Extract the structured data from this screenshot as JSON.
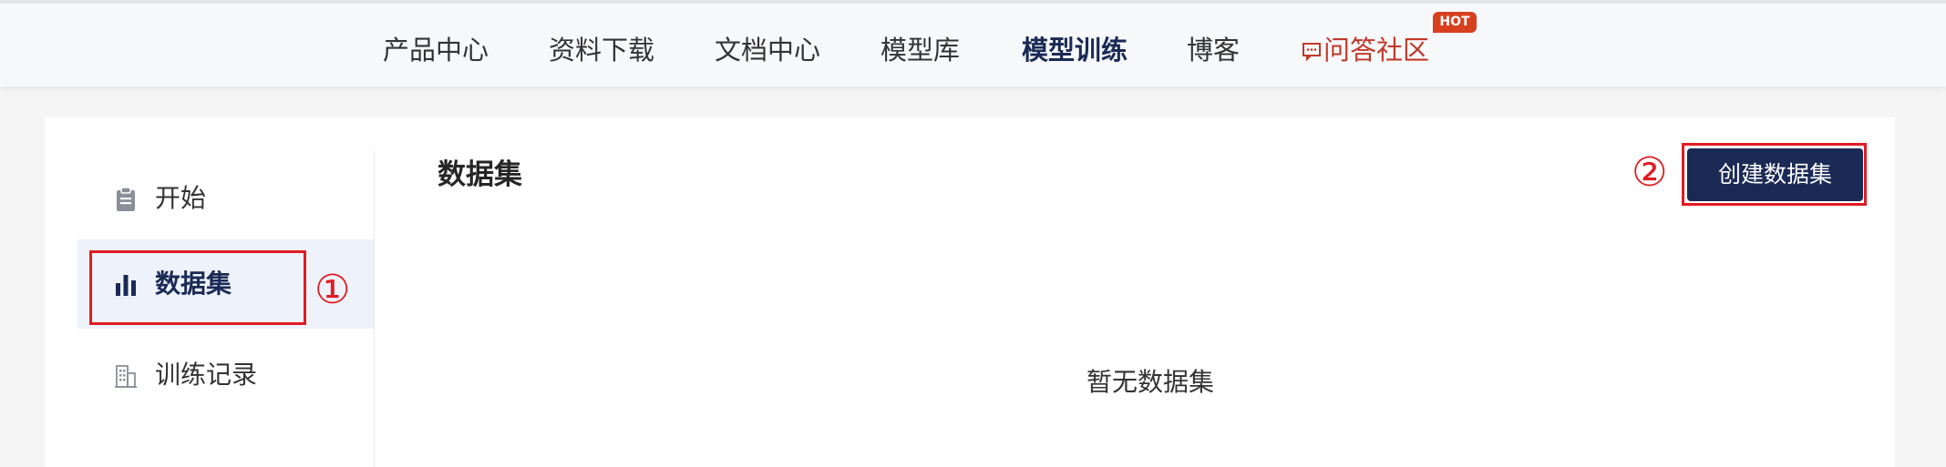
{
  "top_nav": {
    "items": [
      {
        "label": "产品中心"
      },
      {
        "label": "资料下载"
      },
      {
        "label": "文档中心"
      },
      {
        "label": "模型库"
      },
      {
        "label": "模型训练",
        "active": true
      },
      {
        "label": "博客"
      },
      {
        "label": "问答社区",
        "icon": "chat-icon"
      }
    ],
    "hot_badge": "HOT"
  },
  "sidebar": {
    "items": [
      {
        "label": "开始",
        "icon": "clipboard-icon"
      },
      {
        "label": "数据集",
        "icon": "bar-chart-icon",
        "active": true
      },
      {
        "label": "训练记录",
        "icon": "building-icon"
      }
    ]
  },
  "main": {
    "title": "数据集",
    "create_button": "创建数据集",
    "empty_text": "暂无数据集"
  },
  "annotations": {
    "marker_1": "①",
    "marker_2": "②"
  },
  "colors": {
    "brand_navy": "#1b2a55",
    "community_red": "#c0392b",
    "hot_badge": "#d6401f",
    "annotation_red": "#e11b23",
    "active_bg": "#eef2fb"
  }
}
